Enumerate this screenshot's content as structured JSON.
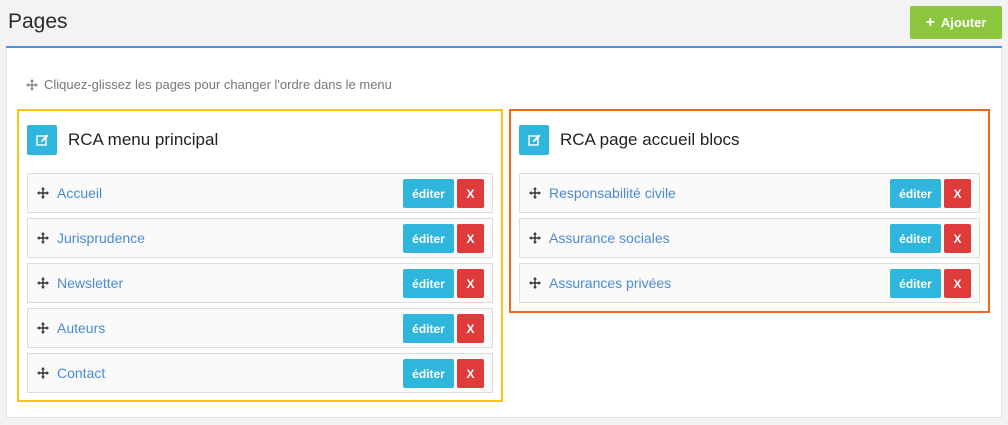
{
  "header": {
    "title": "Pages",
    "add_label": "Ajouter"
  },
  "hint": "Cliquez-glissez les pages pour changer l'ordre dans le menu",
  "menus": [
    {
      "title": "RCA menu principal",
      "items": [
        {
          "label": "Accueil",
          "edit": "éditer",
          "delete": "X"
        },
        {
          "label": "Jurisprudence",
          "edit": "éditer",
          "delete": "X"
        },
        {
          "label": "Newsletter",
          "edit": "éditer",
          "delete": "X"
        },
        {
          "label": "Auteurs",
          "edit": "éditer",
          "delete": "X"
        },
        {
          "label": "Contact",
          "edit": "éditer",
          "delete": "X"
        }
      ]
    },
    {
      "title": "RCA page accueil blocs",
      "items": [
        {
          "label": "Responsabilité civile",
          "edit": "éditer",
          "delete": "X"
        },
        {
          "label": "Assurance sociales",
          "edit": "éditer",
          "delete": "X"
        },
        {
          "label": "Assurances privées",
          "edit": "éditer",
          "delete": "X"
        }
      ]
    }
  ],
  "colors": {
    "accent_blue": "#4e8fd9",
    "add_green": "#8cc63f",
    "edit_cyan": "#2fb6dc",
    "delete_red": "#e03b3b",
    "highlight_yellow": "#f5c518",
    "highlight_orange": "#ee6a1f"
  }
}
